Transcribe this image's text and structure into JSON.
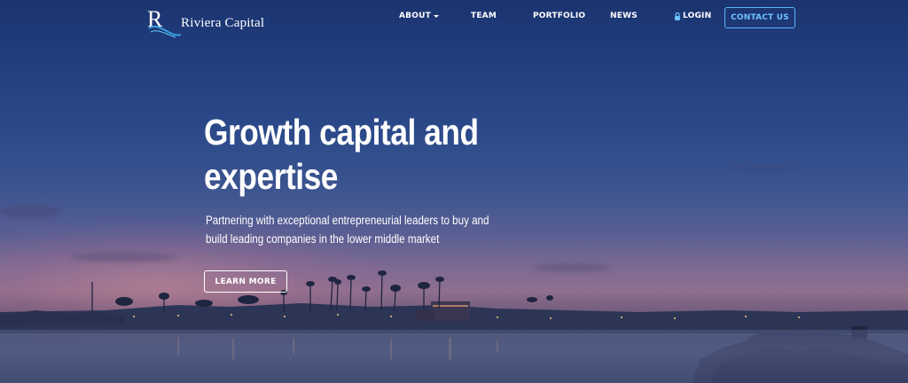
{
  "brand": {
    "name": "Riviera Capital",
    "logo_letter": "R"
  },
  "nav": {
    "items": [
      {
        "label": "ABOUT",
        "has_dropdown": true
      },
      {
        "label": "TEAM"
      },
      {
        "label": "PORTFOLIO"
      },
      {
        "label": "NEWS"
      },
      {
        "label": "LOGIN",
        "icon": "lock-icon"
      }
    ],
    "cta": "CONTACT US"
  },
  "hero": {
    "headline": "Growth capital and expertise",
    "subhead": "Partnering with exceptional entrepreneurial leaders to buy and build leading companies in the lower middle market",
    "button": "LEARN MORE"
  },
  "colors": {
    "sky_top": "#1b3470",
    "sunset": "#8f6f8e",
    "cta_border": "#5ab4ff",
    "text": "#ffffff"
  }
}
